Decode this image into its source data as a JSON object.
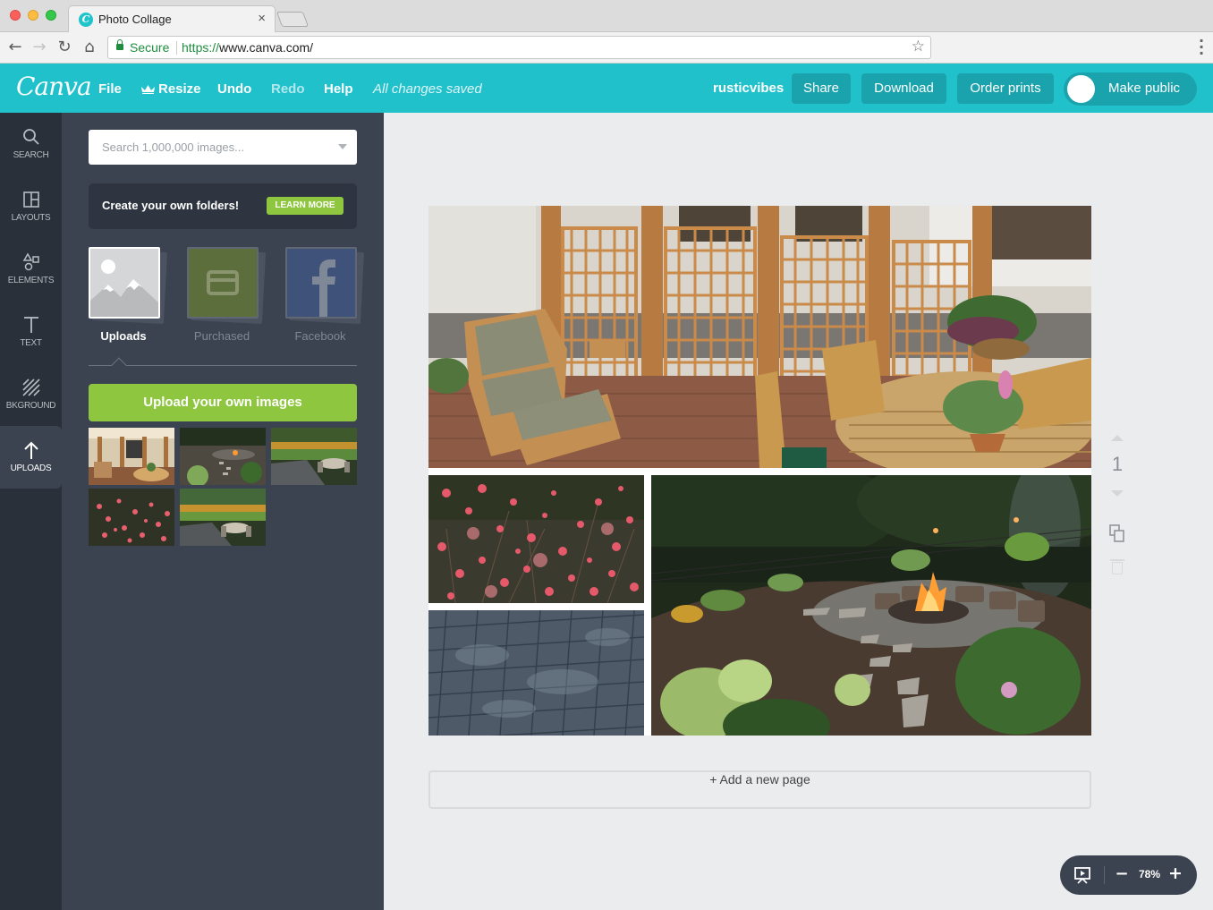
{
  "browser": {
    "tab_title": "Photo Collage",
    "tab_favicon": "C",
    "tab_close": "×",
    "secure_label": "Secure",
    "url_scheme": "https://",
    "url_rest": "www.canva.com/",
    "icons": {
      "back": "←",
      "forward": "→",
      "reload": "↻",
      "home": "⌂",
      "star": "☆",
      "menu": "⋮"
    }
  },
  "header": {
    "logo": "Canva",
    "nav": [
      {
        "label": "File",
        "enabled": true
      },
      {
        "label": "Resize",
        "enabled": true
      },
      {
        "label": "Undo",
        "enabled": true
      },
      {
        "label": "Redo",
        "enabled": false
      },
      {
        "label": "Help",
        "enabled": true
      }
    ],
    "save_status": "All changes saved",
    "username": "rusticvibes",
    "buttons": {
      "share": "Share",
      "download": "Download",
      "order_prints": "Order prints"
    },
    "make_public": {
      "label": "Make public",
      "on": false
    }
  },
  "rail": {
    "items": [
      {
        "label": "SEARCH",
        "icon": "search-icon",
        "active": false
      },
      {
        "label": "LAYOUTS",
        "icon": "layouts-icon",
        "active": false
      },
      {
        "label": "ELEMENTS",
        "icon": "elements-icon",
        "active": false
      },
      {
        "label": "TEXT",
        "icon": "text-icon",
        "active": false
      },
      {
        "label": "BKGROUND",
        "icon": "background-icon",
        "active": false
      },
      {
        "label": "UPLOADS",
        "icon": "upload-arrow-icon",
        "active": true
      }
    ]
  },
  "panel": {
    "search_placeholder": "Search 1,000,000 images...",
    "promo_text": "Create your own folders!",
    "learn_more": "LEARN MORE",
    "sources": [
      {
        "label": "Uploads",
        "active": true
      },
      {
        "label": "Purchased",
        "active": false
      },
      {
        "label": "Facebook",
        "active": false
      }
    ],
    "upload_button": "Upload your own images",
    "thumbnails": [
      {
        "subject": "patio with wooden trellis"
      },
      {
        "subject": "garden fire pit"
      },
      {
        "subject": "garden dining area"
      },
      {
        "subject": "pink flowers"
      },
      {
        "subject": "garden dining area with hedge"
      }
    ]
  },
  "canvas": {
    "photos": [
      {
        "subject": "wooden patio with lounge chair and table"
      },
      {
        "subject": "pink coral bell flowers"
      },
      {
        "subject": "blue stone pavers"
      },
      {
        "subject": "backyard fire pit with stepping stones"
      }
    ],
    "page_number": "1",
    "add_page": "+ Add a new page",
    "zoom": "78%",
    "zoom_minus": "−",
    "zoom_plus": "+"
  },
  "colors": {
    "brand": "#21c1cc",
    "brand_dark": "#1aa3ad",
    "accent_green": "#8ec63f",
    "panel": "#3c4350",
    "rail": "#293039"
  }
}
